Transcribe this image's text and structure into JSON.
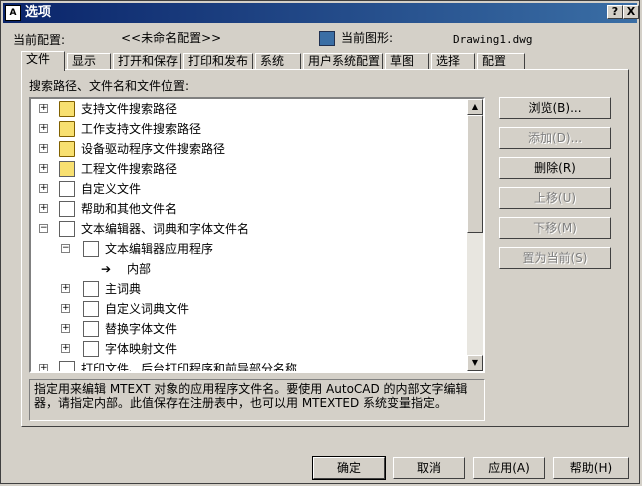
{
  "window": {
    "title": "选项",
    "help_btn": "?",
    "close_btn": "X",
    "app_icon": "A"
  },
  "header": {
    "profile_label": "当前配置:",
    "profile_value": "<<未命名配置>>",
    "drawing_label": "当前图形:",
    "drawing_value": "Drawing1.dwg"
  },
  "tabs": [
    "文件",
    "显示",
    "打开和保存",
    "打印和发布",
    "系统",
    "用户系统配置",
    "草图",
    "选择",
    "配置"
  ],
  "section_label": "搜索路径、文件名和文件位置:",
  "tree": [
    {
      "label": "支持文件搜索路径",
      "icon": "folder"
    },
    {
      "label": "工作支持文件搜索路径",
      "icon": "folder"
    },
    {
      "label": "设备驱动程序文件搜索路径",
      "icon": "folder"
    },
    {
      "label": "工程文件搜索路径",
      "icon": "doc"
    },
    {
      "label": "自定义文件",
      "icon": "doc"
    },
    {
      "label": "帮助和其他文件名",
      "icon": "doc"
    },
    {
      "label": "文本编辑器、词典和字体文件名",
      "icon": "doc"
    },
    {
      "label": "文本编辑器应用程序",
      "icon": "doc"
    },
    {
      "label": "内部",
      "icon": "arrow"
    },
    {
      "label": "主词典",
      "icon": "doc"
    },
    {
      "label": "自定义词典文件",
      "icon": "doc"
    },
    {
      "label": "替换字体文件",
      "icon": "doc"
    },
    {
      "label": "字体映射文件",
      "icon": "doc"
    },
    {
      "label": "打印文件、后台打印程序和前导部分名称",
      "icon": "doc"
    }
  ],
  "description": "指定用来编辑 MTEXT 对象的应用程序文件名。要使用 AutoCAD 的内部文字编辑器，请指定内部。此值保存在注册表中，也可以用 MTEXTED 系统变量指定。",
  "side_buttons": {
    "browse": "浏览(B)...",
    "add": "添加(D)...",
    "remove": "删除(R)",
    "move_up": "上移(U)",
    "move_down": "下移(M)",
    "set_current": "置为当前(S)"
  },
  "footer": {
    "ok": "确定",
    "cancel": "取消",
    "apply": "应用(A)",
    "help": "帮助(H)"
  }
}
